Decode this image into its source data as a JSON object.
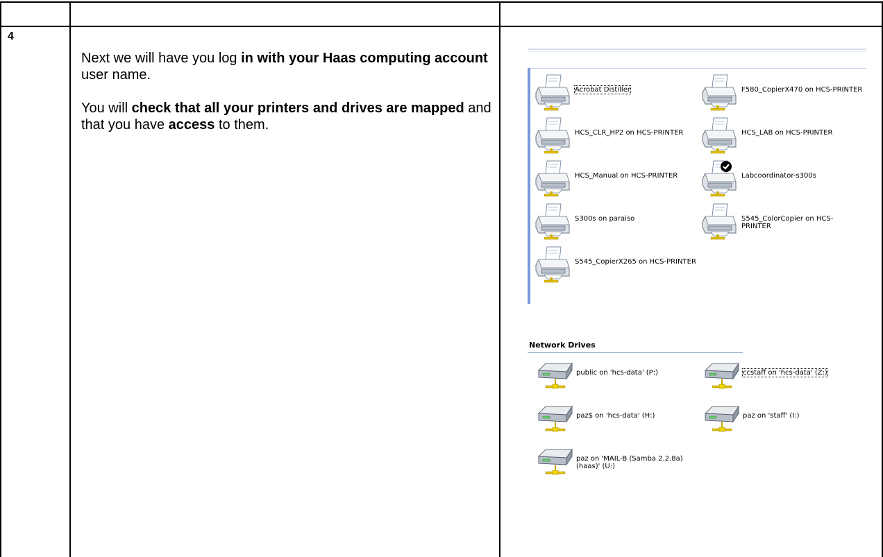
{
  "step": {
    "number": "4"
  },
  "instructions": {
    "p1": {
      "t1": "Next we will have you log ",
      "b1": "in with your Haas computing account",
      "t2": " user name."
    },
    "p2": {
      "t1": "You will ",
      "b1": "check that all your printers and drives are mapped",
      "t2": " and that you have ",
      "b2": "access",
      "t3": " to them."
    }
  },
  "printers": [
    {
      "label": "Acrobat Distiller",
      "default": false,
      "focused": true
    },
    {
      "label": "F580_CopierX470 on HCS-PRINTER",
      "default": false
    },
    {
      "label": "HCS_CLR_HP2 on HCS-PRINTER",
      "default": false
    },
    {
      "label": "HCS_LAB on HCS-PRINTER",
      "default": false
    },
    {
      "label": "HCS_Manual on HCS-PRINTER",
      "default": false
    },
    {
      "label": "Labcoordinator-s300s",
      "default": true
    },
    {
      "label": "S300s on paraiso",
      "default": false
    },
    {
      "label": "S545_ColorCopier on HCS-PRINTER",
      "default": false
    },
    {
      "label": "S545_CopierX265 on HCS-PRINTER",
      "default": false
    }
  ],
  "network_drives": {
    "title": "Network Drives",
    "items": [
      {
        "label": "public on 'hcs-data' (P:)"
      },
      {
        "label": "ccstaff on 'hcs-data' (Z:)",
        "focused": true
      },
      {
        "label": "paz$ on 'hcs-data' (H:)"
      },
      {
        "label": "paz on 'staff' (I:)"
      },
      {
        "label": "paz on 'MAIL-B (Samba 2.2.8a) (haas)' (U:)"
      }
    ]
  },
  "icons": {
    "printer": "printer-icon",
    "drive": "network-drive-icon",
    "default_check": "check-icon"
  }
}
